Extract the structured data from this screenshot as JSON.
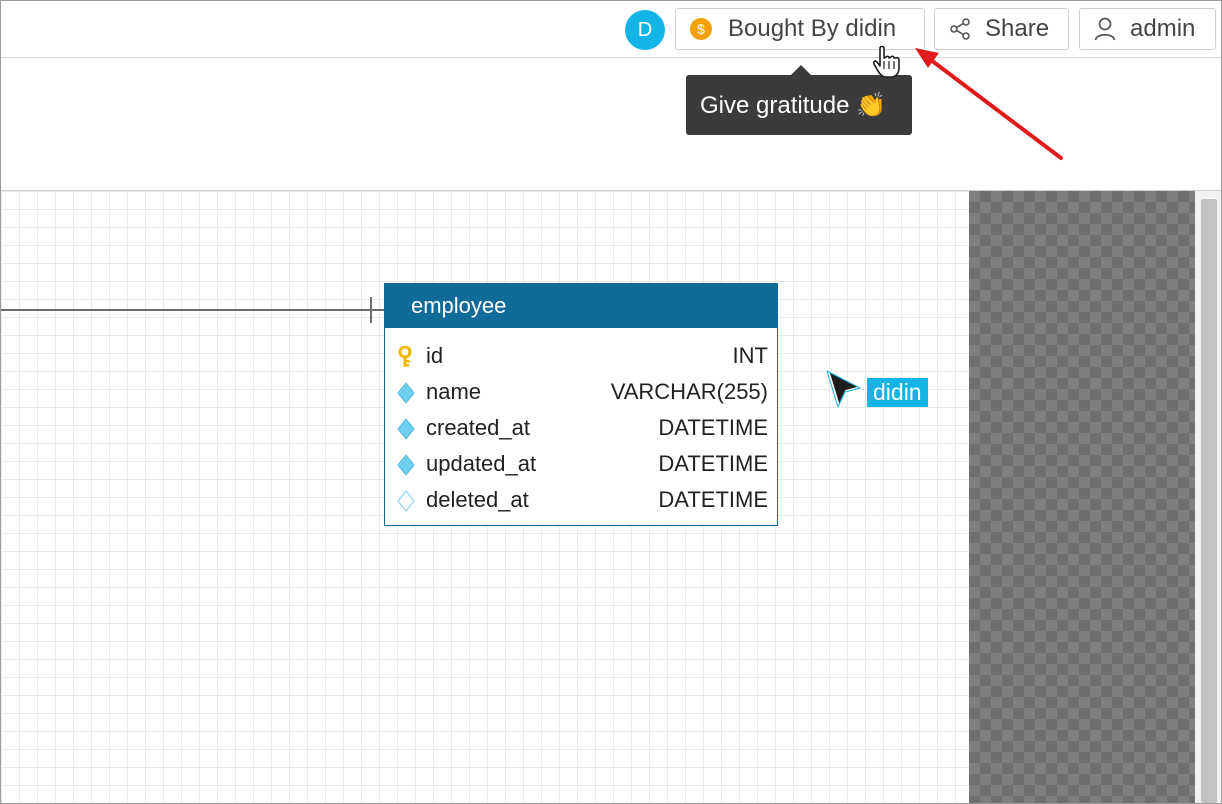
{
  "header": {
    "avatar_initial": "D",
    "bought_label": "Bought By didin",
    "coin_symbol": "$",
    "share_label": "Share",
    "user_label": "admin"
  },
  "tooltip": {
    "text": "Give gratitude 👏"
  },
  "colors": {
    "accent": "#13b4e8",
    "entity_header": "#106a9a",
    "coin": "#f5a10a",
    "annotation_arrow": "#e01b1b"
  },
  "entity": {
    "name": "employee",
    "fields": [
      {
        "name": "id",
        "type": "INT",
        "icon": "primary-key-icon"
      },
      {
        "name": "name",
        "type": "VARCHAR(255)",
        "icon": "not-null-column-icon"
      },
      {
        "name": "created_at",
        "type": "DATETIME",
        "icon": "not-null-column-icon"
      },
      {
        "name": "updated_at",
        "type": "DATETIME",
        "icon": "not-null-column-icon"
      },
      {
        "name": "deleted_at",
        "type": "DATETIME",
        "icon": "nullable-column-icon"
      }
    ]
  },
  "collaborator": {
    "name": "didin"
  }
}
